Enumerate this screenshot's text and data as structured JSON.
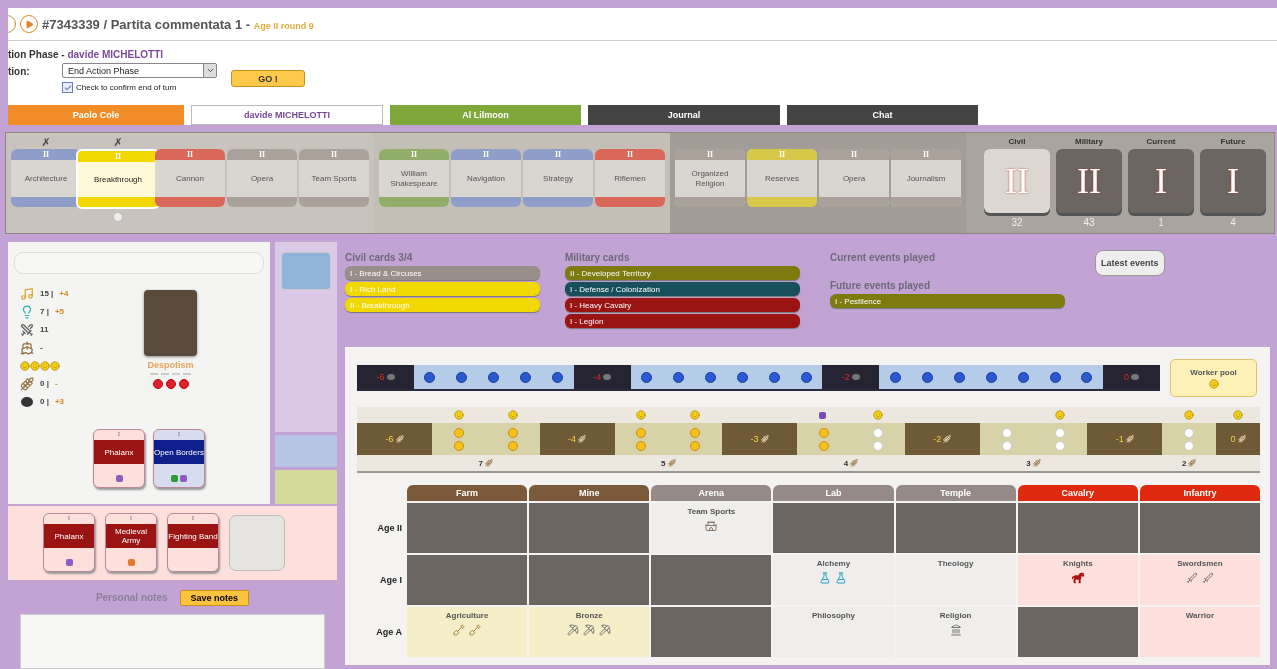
{
  "header": {
    "title": "#7343339 / Partita commentata 1 - ",
    "round": "Age II round 9",
    "phase": "tion Phase - ",
    "player": "davide MICHELOTTI",
    "action_label": "tion:",
    "action_select": "End Action Phase",
    "confirm": {
      "label": "Check to confirm end of turn",
      "checked": true
    },
    "go_button": "GO !"
  },
  "player_tabs": [
    {
      "label": "Paolo Cole",
      "color": "#f28c28",
      "selected": false
    },
    {
      "label": "davide MICHELOTTI",
      "color": "#ffffff",
      "selected": true
    },
    {
      "label": "Al Lilmoon",
      "color": "#7fa83a",
      "selected": false
    },
    {
      "label": "Journal",
      "color": "#444444",
      "selected": false
    },
    {
      "label": "Chat",
      "color": "#444444",
      "selected": false
    }
  ],
  "card_row": {
    "sections": [
      {
        "cards": [
          {
            "age": "II",
            "name": "Architecture",
            "color": "#8e9ec8",
            "mark": "✗",
            "selected": false
          },
          {
            "age": "II",
            "name": "Breakthrough",
            "color": "#f1d800",
            "mark": "✗",
            "selected": true
          },
          {
            "age": "II",
            "name": "Cannon",
            "color": "#d9685a",
            "selected": false
          },
          {
            "age": "II",
            "name": "Opera",
            "color": "#aaa19b",
            "selected": false
          },
          {
            "age": "II",
            "name": "Team Sports",
            "color": "#aaa19b",
            "selected": false
          }
        ]
      },
      {
        "cards": [
          {
            "age": "II",
            "name": "William Shakespeare",
            "color": "#92ad6a",
            "selected": false
          },
          {
            "age": "II",
            "name": "Navigation",
            "color": "#8e9ec8",
            "selected": false
          },
          {
            "age": "II",
            "name": "Strategy",
            "color": "#8e9ec8",
            "selected": false
          },
          {
            "age": "II",
            "name": "Riflemen",
            "color": "#d9685a",
            "selected": false
          }
        ]
      },
      {
        "cards": [
          {
            "age": "II",
            "name": "Organized Religion",
            "color": "#aaa19b",
            "selected": false
          },
          {
            "age": "II",
            "name": "Reserves",
            "color": "#d8c84a",
            "selected": false
          },
          {
            "age": "II",
            "name": "Opera",
            "color": "#aaa19b",
            "selected": false
          },
          {
            "age": "II",
            "name": "Journalism",
            "color": "#aaa19b",
            "selected": false
          }
        ]
      }
    ],
    "decks": [
      {
        "label": "Civil",
        "kind": "civil",
        "age": "II",
        "count": "32"
      },
      {
        "label": "Military",
        "kind": "military",
        "age": "II",
        "count": "43"
      },
      {
        "label": "Current",
        "kind": "event",
        "age": "I",
        "count": "1"
      },
      {
        "label": "Future",
        "kind": "event",
        "age": "I",
        "count": "4"
      }
    ]
  },
  "stats": [
    {
      "kind": "culture",
      "value": "15 |",
      "bonus": "+4"
    },
    {
      "kind": "science",
      "value": "7 |",
      "bonus": "+5"
    },
    {
      "kind": "strength",
      "value": "11"
    },
    {
      "kind": "colonization",
      "value": "-"
    },
    {
      "kind": "happiness",
      "faces": [
        {
          "kind": "smile"
        },
        {
          "kind": "smile"
        },
        {
          "kind": "smile"
        },
        {
          "kind": "smile"
        }
      ]
    },
    {
      "kind": "food",
      "value": "0 |",
      "bonus": "-"
    },
    {
      "kind": "resource",
      "value": "0 |",
      "bonus": "+3"
    }
  ],
  "leader": {
    "government": "Despotism",
    "military_actions": [
      {
        "filled": true
      },
      {
        "filled": true
      },
      {
        "filled": true
      }
    ]
  },
  "cards_in_play": [
    {
      "kind": "military",
      "age": "I",
      "name": "Phalanx",
      "tokens": [
        {
          "color": "#8e5cc0"
        }
      ]
    },
    {
      "kind": "civil",
      "age": "I",
      "name": "Open Borders",
      "tokens": [
        {
          "color": "#2f9a3a"
        },
        {
          "color": "#8e5cc0"
        }
      ]
    }
  ],
  "military_units": [
    {
      "age": "I",
      "name": "Phalanx",
      "tokens": [
        {
          "color": "#8e5cc0"
        }
      ]
    },
    {
      "age": "I",
      "name": "Medieval Army",
      "tokens": [
        {
          "color": "#e07a2a"
        }
      ]
    },
    {
      "age": "I",
      "name": "Fighting Band"
    }
  ],
  "notes": {
    "label": "Personal notes",
    "button": "Save notes"
  },
  "civil_cards": {
    "title": "Civil cards 3/4",
    "items": [
      {
        "text": "I - Bread & Circuses",
        "color": "#9a8e8a"
      },
      {
        "text": "I - Rich Land",
        "color": "#f1d800"
      },
      {
        "text": "II - Breakthrough",
        "color": "#f1d800"
      }
    ]
  },
  "military_cards": {
    "title": "Military cards",
    "items": [
      {
        "text": "II - Developed Territory",
        "color": "#7d7a10"
      },
      {
        "text": "I - Defense / Colonization",
        "color": "#17505a"
      },
      {
        "text": "I - Heavy Cavalry",
        "color": "#9b1414"
      },
      {
        "text": "I - Legion",
        "color": "#9b1414"
      }
    ]
  },
  "current_events": {
    "title": "Current events played"
  },
  "future_events": {
    "title": "Future events played",
    "items": [
      {
        "text": "I - Pestilence",
        "color": "#7d7a10"
      }
    ]
  },
  "latest_events_button": "Latest events",
  "resource_track": [
    {
      "kind": "value",
      "text": "-6"
    },
    {
      "kind": "slots",
      "slots": [
        {
          "filled": true
        },
        {
          "filled": true
        },
        {
          "filled": true
        },
        {
          "filled": true
        },
        {
          "filled": true
        }
      ]
    },
    {
      "kind": "value",
      "text": "-4"
    },
    {
      "kind": "slots",
      "slots": [
        {
          "filled": true
        },
        {
          "filled": true
        },
        {
          "filled": true
        },
        {
          "filled": true
        },
        {
          "filled": true
        },
        {
          "filled": true
        }
      ]
    },
    {
      "kind": "value",
      "text": "-2"
    },
    {
      "kind": "slots",
      "slots": [
        {
          "filled": true
        },
        {
          "filled": true
        },
        {
          "filled": true
        },
        {
          "filled": true
        },
        {
          "filled": true
        },
        {
          "filled": true
        },
        {
          "filled": true
        }
      ]
    },
    {
      "kind": "value",
      "text": "0"
    }
  ],
  "worker_pool": {
    "label": "Worker pool",
    "faces": [
      {
        "kind": "smile"
      }
    ]
  },
  "food_track": [
    {
      "kind": "value",
      "text": "-6"
    },
    {
      "kind": "group",
      "label": "7",
      "columns": [
        {
          "face": true,
          "tokens": [
            {
              "filled": true
            },
            {
              "filled": true
            }
          ]
        },
        {
          "face": true,
          "tokens": [
            {
              "filled": true
            },
            {
              "filled": true
            }
          ]
        }
      ]
    },
    {
      "kind": "value",
      "text": "-4"
    },
    {
      "kind": "group",
      "label": "5",
      "columns": [
        {
          "face": true,
          "tokens": [
            {
              "filled": true
            },
            {
              "filled": true
            }
          ]
        },
        {
          "face": true,
          "tokens": [
            {
              "filled": true
            },
            {
              "filled": true
            }
          ]
        }
      ]
    },
    {
      "kind": "value",
      "text": "-3"
    },
    {
      "kind": "group",
      "label": "4",
      "columns": [
        {
          "cube": true,
          "tokens": [
            {
              "filled": true
            },
            {
              "filled": true
            }
          ]
        },
        {
          "face": true,
          "tokens": [
            {
              "filled": false
            },
            {
              "filled": false
            }
          ]
        }
      ]
    },
    {
      "kind": "value",
      "text": "-2"
    },
    {
      "kind": "group",
      "label": "3",
      "columns": [
        {
          "tokens": [
            {
              "filled": false
            },
            {
              "filled": false
            }
          ]
        },
        {
          "face": true,
          "tokens": [
            {
              "filled": false
            },
            {
              "filled": false
            }
          ]
        }
      ]
    },
    {
      "kind": "value",
      "text": "-1"
    },
    {
      "kind": "group",
      "label": "2",
      "columns": [
        {
          "face": true,
          "tokens": [
            {
              "filled": false
            },
            {
              "filled": false
            }
          ]
        }
      ]
    },
    {
      "kind": "value",
      "text": "0",
      "face": true
    }
  ],
  "tech_grid": {
    "columns": [
      {
        "name": "Farm",
        "kind": "production"
      },
      {
        "name": "Mine",
        "kind": "production"
      },
      {
        "name": "Arena",
        "kind": "urban"
      },
      {
        "name": "Lab",
        "kind": "urban"
      },
      {
        "name": "Temple",
        "kind": "urban"
      },
      {
        "name": "Cavalry",
        "kind": "military"
      },
      {
        "name": "Infantry",
        "kind": "military"
      }
    ],
    "rows": [
      {
        "label": "Age II",
        "cells": [
          null,
          null,
          {
            "name": "Team Sports",
            "workers": [
              {
                "kind": "arena"
              }
            ]
          },
          null,
          null,
          null,
          null
        ]
      },
      {
        "label": "Age I",
        "cells": [
          null,
          null,
          null,
          {
            "name": "Alchemy",
            "workers": [
              {
                "kind": "flask"
              },
              {
                "kind": "flask"
              }
            ]
          },
          {
            "name": "Theology"
          },
          {
            "name": "Knights",
            "workers": [
              {
                "kind": "horse"
              }
            ]
          },
          {
            "name": "Swordsmen",
            "workers": [
              {
                "kind": "sword"
              },
              {
                "kind": "sword"
              }
            ]
          }
        ]
      },
      {
        "label": "Age A",
        "cells": [
          {
            "name": "Agriculture",
            "workers": [
              {
                "kind": "farm"
              },
              {
                "kind": "farm"
              }
            ]
          },
          {
            "name": "Bronze",
            "workers": [
              {
                "kind": "pick"
              },
              {
                "kind": "pick"
              },
              {
                "kind": "pick"
              }
            ]
          },
          null,
          {
            "name": "Philosophy"
          },
          {
            "name": "Religion",
            "workers": [
              {
                "kind": "temple"
              }
            ]
          },
          null,
          {
            "name": "Warrior"
          }
        ]
      }
    ]
  }
}
